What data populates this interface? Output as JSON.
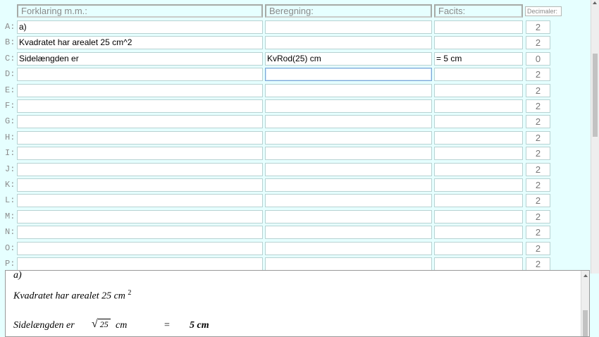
{
  "header": {
    "col1": "Forklaring m.m.:",
    "col2": "Beregning:",
    "col3": "Facits:",
    "col4": "Decimaler:"
  },
  "rows": [
    {
      "label": "A:",
      "forklaring": "a)",
      "beregning": "",
      "facit": "",
      "decimals": "2"
    },
    {
      "label": "B:",
      "forklaring": "Kvadratet har arealet 25 cm^2",
      "beregning": "",
      "facit": "",
      "decimals": "2"
    },
    {
      "label": "C:",
      "forklaring": "Sidelængden er",
      "beregning": "KvRod(25) cm",
      "facit": "=  5  cm",
      "decimals": "0"
    },
    {
      "label": "D:",
      "forklaring": "",
      "beregning": "",
      "facit": "",
      "decimals": "2"
    },
    {
      "label": "E:",
      "forklaring": "",
      "beregning": "",
      "facit": "",
      "decimals": "2"
    },
    {
      "label": "F:",
      "forklaring": "",
      "beregning": "",
      "facit": "",
      "decimals": "2"
    },
    {
      "label": "G:",
      "forklaring": "",
      "beregning": "",
      "facit": "",
      "decimals": "2"
    },
    {
      "label": "H:",
      "forklaring": "",
      "beregning": "",
      "facit": "",
      "decimals": "2"
    },
    {
      "label": "I:",
      "forklaring": "",
      "beregning": "",
      "facit": "",
      "decimals": "2"
    },
    {
      "label": "J:",
      "forklaring": "",
      "beregning": "",
      "facit": "",
      "decimals": "2"
    },
    {
      "label": "K:",
      "forklaring": "",
      "beregning": "",
      "facit": "",
      "decimals": "2"
    },
    {
      "label": "L:",
      "forklaring": "",
      "beregning": "",
      "facit": "",
      "decimals": "2"
    },
    {
      "label": "M:",
      "forklaring": "",
      "beregning": "",
      "facit": "",
      "decimals": "2"
    },
    {
      "label": "N:",
      "forklaring": "",
      "beregning": "",
      "facit": "",
      "decimals": "2"
    },
    {
      "label": "O:",
      "forklaring": "",
      "beregning": "",
      "facit": "",
      "decimals": "2"
    },
    {
      "label": "P:",
      "forklaring": "",
      "beregning": "",
      "facit": "",
      "decimals": "2"
    }
  ],
  "preview": {
    "line1": "a)",
    "line2_text": "Kvadratet har arealet 25 cm",
    "line2_exp": "2",
    "line3_text": "Sidelængden er",
    "line3_radicand": "25",
    "line3_unit": "cm",
    "line3_eq": "=",
    "line3_result": "5 cm"
  },
  "colors": {
    "background": "#e6ffff",
    "focus_border": "#7aa7d8"
  }
}
